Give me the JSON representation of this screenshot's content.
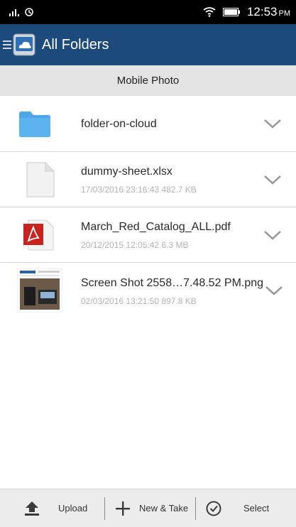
{
  "status_bar": {
    "time": "12:53",
    "ampm": "PM",
    "signal_icon": "signal-bars-icon",
    "wifi_icon": "wifi-icon",
    "battery_icon": "battery-icon"
  },
  "app_bar": {
    "title": "All Folders",
    "menu_icon": "hamburger-menu-icon",
    "logo_icon": "cloud-logo-icon"
  },
  "section": {
    "title": "Mobile Photo"
  },
  "files": [
    {
      "name": "folder-on-cloud",
      "meta": "",
      "type": "folder"
    },
    {
      "name": "dummy-sheet.xlsx",
      "meta": "17/03/2016 23:16:43 482.7 KB",
      "type": "document"
    },
    {
      "name": "March_Red_Catalog_ALL.pdf",
      "meta": "20/12/2015 12:05:42 6.3 MB",
      "type": "pdf"
    },
    {
      "name": "Screen Shot 2558…7.48.52 PM.png",
      "meta": "02/03/2016 13:21:50 897.8 KB",
      "type": "image"
    }
  ],
  "bottom_bar": {
    "upload_label": "Upload",
    "new_take_label": "New & Take",
    "select_label": "Select"
  },
  "colors": {
    "app_bar": "#1c4a7a",
    "section_header": "#e4e4e4",
    "folder": "#4fa6e6",
    "pdf": "#c8231f"
  }
}
